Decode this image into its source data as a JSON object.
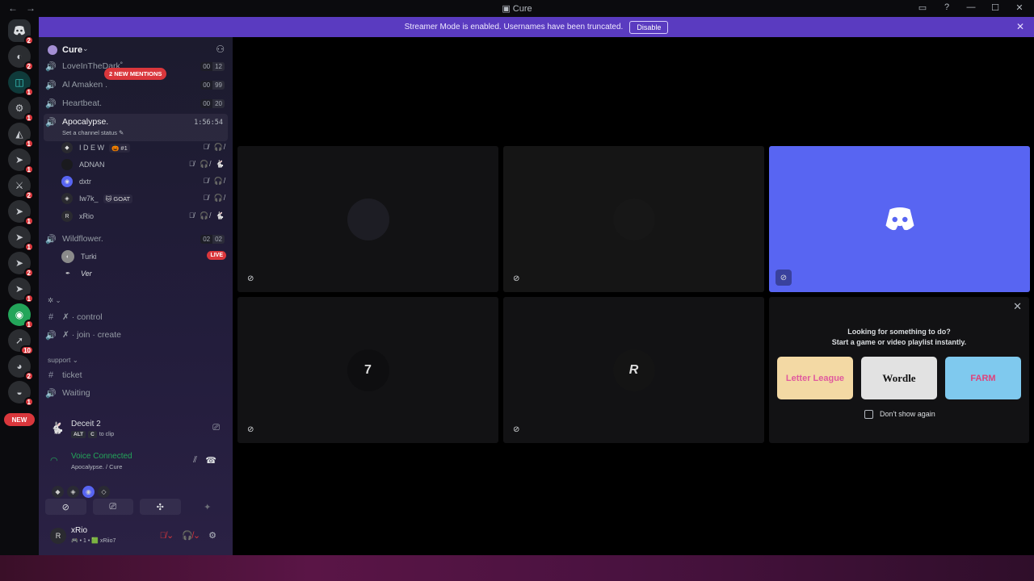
{
  "window": {
    "title": "Cure",
    "back": "←",
    "forward": "→",
    "ctrl_inbox": "▭",
    "ctrl_help": "?",
    "ctrl_min": "—",
    "ctrl_max": "☐",
    "ctrl_close": "✕"
  },
  "banner": {
    "text": "Streamer Mode is enabled. Usernames have been truncated.",
    "button": "Disable",
    "close": "✕"
  },
  "guilds": {
    "home_badge": "2",
    "badges": [
      "2",
      "1",
      "1",
      "1",
      "1",
      "2",
      "1",
      "1",
      "2",
      "1",
      "1",
      "10",
      "2",
      "1"
    ],
    "new_label": "NEW"
  },
  "server": {
    "name": "Cure",
    "new_mentions": "2 NEW MENTIONS"
  },
  "channels": [
    {
      "name": "LoveInTheDark˚",
      "c1": "00",
      "c2": "12"
    },
    {
      "name": "Al Amaken .",
      "c1": "00",
      "c2": "99"
    },
    {
      "name": "Heartbeat.",
      "c1": "00",
      "c2": "20"
    }
  ],
  "active_channel": {
    "name": "Apocalypse.",
    "timer": "1:56:54",
    "status": "Set a channel status ✎"
  },
  "voice_users": [
    {
      "name": "I D E W",
      "tag": "🎃 #1",
      "icons": "🎙̸ 🎧̸"
    },
    {
      "name": "ADNAN",
      "tag": "",
      "icons": "🎙̸ 🎧̸ 🐇"
    },
    {
      "name": "dxtr",
      "tag": "",
      "icons": "🎙̸ 🎧̸"
    },
    {
      "name": "Iw7k_",
      "tag": "🐱 GOAT",
      "icons": "🎙̸ 🎧̸"
    },
    {
      "name": "xRio",
      "tag": "",
      "icons": "🎙̸ 🎧̸ 🐇"
    }
  ],
  "wildflower": {
    "name": "Wildflower.",
    "c1": "02",
    "c2": "02"
  },
  "wildflower_users": [
    {
      "name": "Turki",
      "live": "LIVE"
    },
    {
      "name": "Ver"
    }
  ],
  "cat1": {
    "label": "✲ ⌄"
  },
  "text_channels": [
    {
      "name": "✗ ·  control"
    },
    {
      "name": "✗ ·  join ·  create"
    }
  ],
  "cat2": {
    "label": "support ⌄"
  },
  "support_channels": [
    {
      "name": "ticket"
    },
    {
      "name": "Waiting"
    }
  ],
  "activity": {
    "game": "Deceit 2",
    "key1": "ALT",
    "key2": "C",
    "clip": "to clip"
  },
  "voice": {
    "status": "Voice Connected",
    "location": "Apocalypse. / Cure"
  },
  "user": {
    "name": "xRio",
    "status": "🎮 • 1 • 🟩 xRiio7"
  },
  "tiles": [
    {
      "label": ""
    },
    {
      "label": ""
    },
    {
      "label": ""
    },
    {
      "label": "7"
    },
    {
      "label": "R"
    }
  ],
  "activity_panel": {
    "line1": "Looking for something to do?",
    "line2": "Start a game or video playlist instantly.",
    "games": [
      "Letter League",
      "Wordle",
      "FARM"
    ],
    "checkbox_label": "Don't show again"
  }
}
